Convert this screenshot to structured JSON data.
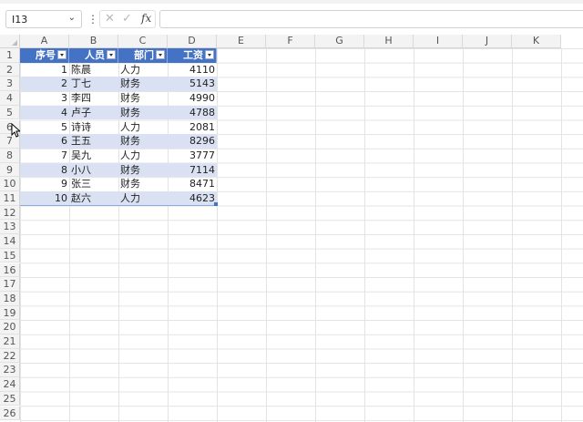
{
  "namebox": {
    "value": "I13",
    "dropdown_glyph": "⌄"
  },
  "formula_bar": {
    "kebab_glyph": "⋮",
    "cancel_glyph": "✕",
    "enter_glyph": "✓",
    "fx_label": "fx",
    "content": ""
  },
  "columns": [
    "A",
    "B",
    "C",
    "D",
    "E",
    "F",
    "G",
    "H",
    "I",
    "J",
    "K"
  ],
  "rows": [
    "1",
    "2",
    "3",
    "4",
    "5",
    "6",
    "7",
    "8",
    "9",
    "10",
    "11",
    "12",
    "13",
    "14",
    "15",
    "16",
    "17",
    "18",
    "19",
    "20",
    "21",
    "22",
    "23",
    "24",
    "25",
    "26"
  ],
  "table": {
    "headers": [
      "序号",
      "人员",
      "部门",
      "工资"
    ],
    "rows": [
      [
        "1",
        "陈晨",
        "人力",
        "4110"
      ],
      [
        "2",
        "丁七",
        "财务",
        "5143"
      ],
      [
        "3",
        "李四",
        "财务",
        "4990"
      ],
      [
        "4",
        "卢子",
        "财务",
        "4788"
      ],
      [
        "5",
        "诗诗",
        "人力",
        "2081"
      ],
      [
        "6",
        "王五",
        "财务",
        "8296"
      ],
      [
        "7",
        "吴九",
        "人力",
        "3777"
      ],
      [
        "8",
        "小八",
        "财务",
        "7114"
      ],
      [
        "9",
        "张三",
        "财务",
        "8471"
      ],
      [
        "10",
        "赵六",
        "人力",
        "4623"
      ]
    ],
    "header_color": "#4472c4",
    "band_color": "#d9e1f2"
  }
}
